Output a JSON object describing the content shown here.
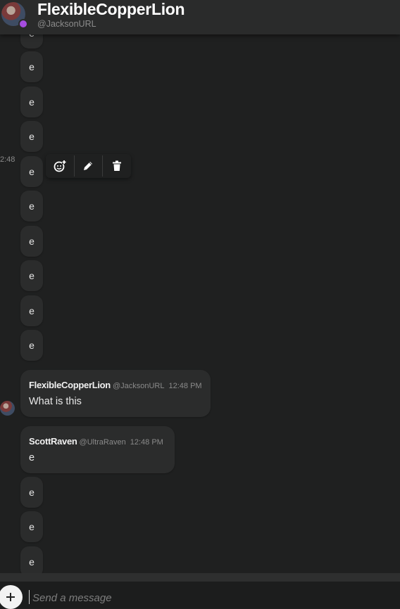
{
  "header": {
    "title": "FlexibleCopperLion",
    "handle": "@JacksonURL"
  },
  "messages": {
    "filler_text": "e",
    "cut_timestamp": "2:48",
    "toolbar": {
      "react_icon": "add-reaction-icon",
      "edit_icon": "pencil-icon",
      "delete_icon": "trash-icon"
    },
    "card1": {
      "name": "FlexibleCopperLion",
      "username": "@JacksonURL",
      "time": "12:48 PM",
      "text": "What is this"
    },
    "card2": {
      "name": "ScottRaven",
      "username": "@UltraRaven",
      "time": "12:48 PM",
      "text": "e"
    }
  },
  "composer": {
    "add_icon": "plus-icon",
    "placeholder": "Send a message"
  },
  "colors": {
    "background": "#1f2020",
    "bubble": "#2b2c2c",
    "header": "#2a2b2b",
    "status": "#a64de0"
  }
}
